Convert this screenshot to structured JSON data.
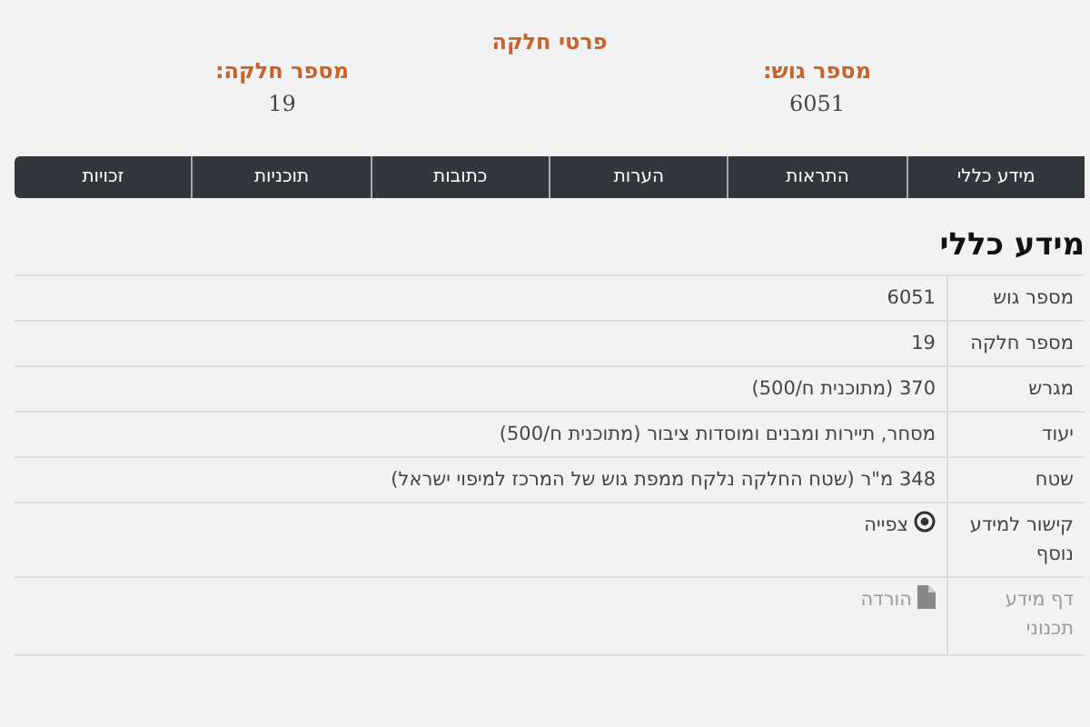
{
  "header": {
    "title": "פרטי חלקה",
    "fields": [
      {
        "label": "מספר גוש:",
        "value": "6051"
      },
      {
        "label": "מספר חלקה:",
        "value": "19"
      }
    ]
  },
  "tabs": [
    {
      "label": "מידע כללי"
    },
    {
      "label": "התראות"
    },
    {
      "label": "הערות"
    },
    {
      "label": "כתובות"
    },
    {
      "label": "תוכניות"
    },
    {
      "label": "זכויות"
    }
  ],
  "section": {
    "title": "מידע כללי",
    "rows": [
      {
        "kind": "text",
        "label": "מספר גוש",
        "value": "6051"
      },
      {
        "kind": "text",
        "label": "מספר חלקה",
        "value": "19"
      },
      {
        "kind": "text",
        "label": "מגרש",
        "value": "370 (מתוכנית ח/500)"
      },
      {
        "kind": "text",
        "label": "יעוד",
        "value": "מסחר, תיירות ומבנים ומוסדות ציבור (מתוכנית ח/500)"
      },
      {
        "kind": "text",
        "label": "שטח",
        "value": "348 מ\"ר (שטח החלקה נלקח ממפת גוש של המרכז למיפוי ישראל)"
      },
      {
        "kind": "view",
        "label": "קישור למידע נוסף",
        "value": "צפייה"
      },
      {
        "kind": "download",
        "label": "דף מידע תכנוני",
        "value": "הורדה"
      }
    ]
  }
}
